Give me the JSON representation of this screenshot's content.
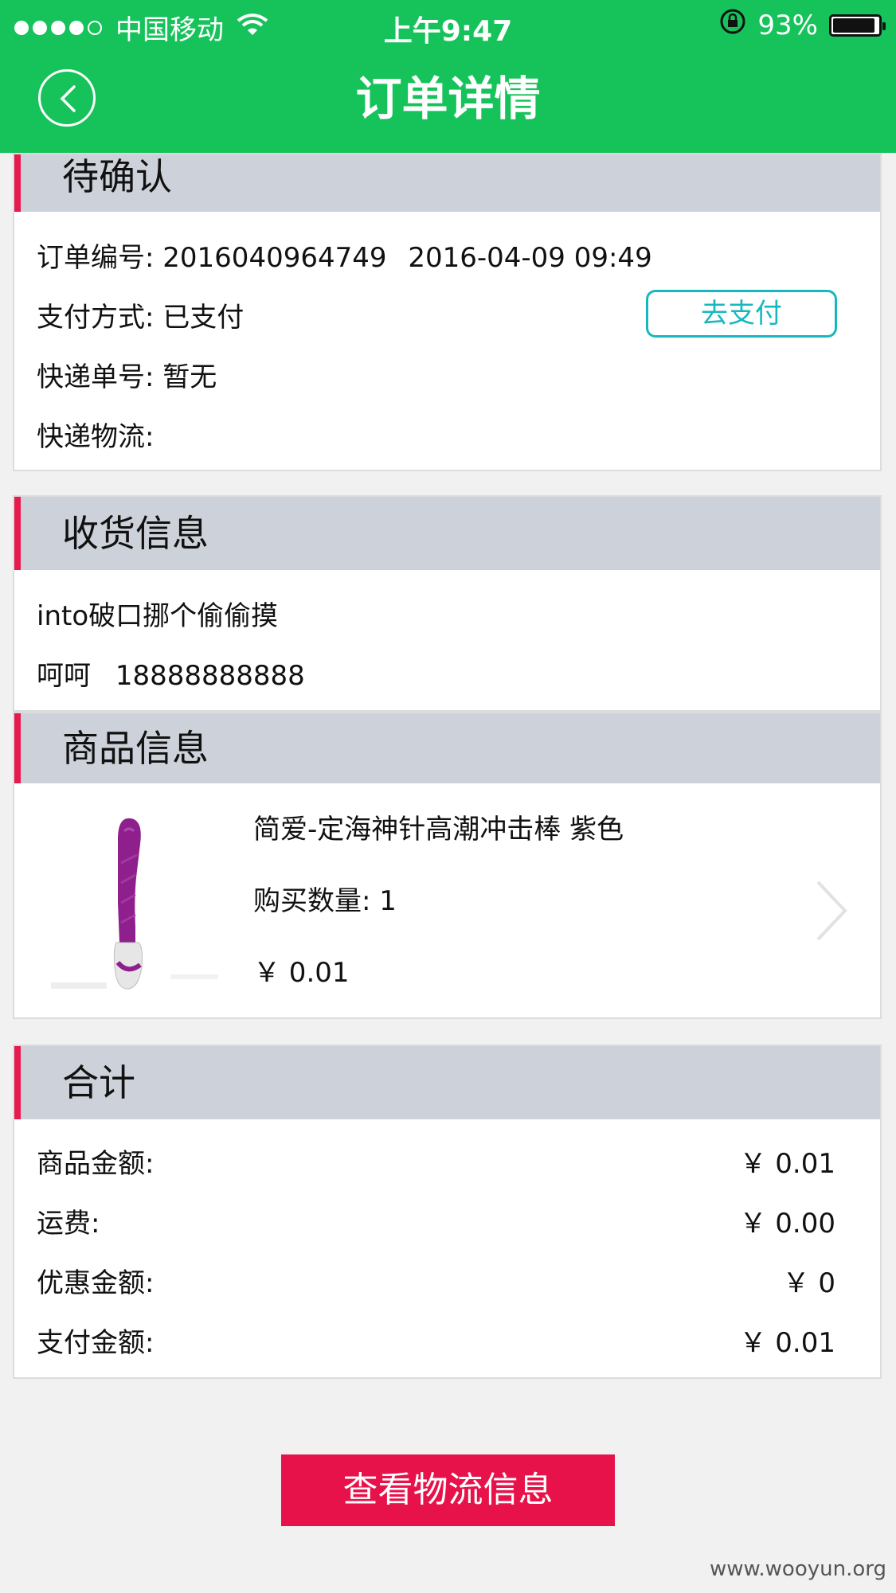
{
  "status_bar": {
    "carrier": "中国移动",
    "time": "上午9:47",
    "battery": "93%"
  },
  "header": {
    "title": "订单详情"
  },
  "order": {
    "status": "待确认",
    "number_label": "订单编号:",
    "number": "2016040964749",
    "datetime": "2016-04-09 09:49",
    "payment_label": "支付方式:",
    "payment_value": "已支付",
    "pay_button": "去支付",
    "tracking_label": "快递单号:",
    "tracking_value": "暂无",
    "logistics_label": "快递物流:"
  },
  "shipping": {
    "title": "收货信息",
    "address": "into破口挪个偷偷摸",
    "name": "呵呵",
    "phone": "18888888888"
  },
  "product": {
    "title": "商品信息",
    "name": "简爱-定海神针高潮冲击棒 紫色",
    "quantity_label": "购买数量:",
    "quantity": "1",
    "price": "￥ 0.01"
  },
  "totals": {
    "title": "合计",
    "rows": [
      {
        "label": "商品金额:",
        "value": "￥ 0.01"
      },
      {
        "label": "运费:",
        "value": "￥ 0.00"
      },
      {
        "label": "优惠金额:",
        "value": "￥ 0"
      },
      {
        "label": "支付金额:",
        "value": "￥ 0.01"
      }
    ]
  },
  "logistics_button": "查看物流信息",
  "watermark": "www.wooyun.org",
  "colors": {
    "header_green": "#16c35b",
    "accent_red": "#e61a4d",
    "button_red": "#e8124a",
    "pay_teal": "#16b8c0",
    "section_gray": "#cdd1d9"
  }
}
